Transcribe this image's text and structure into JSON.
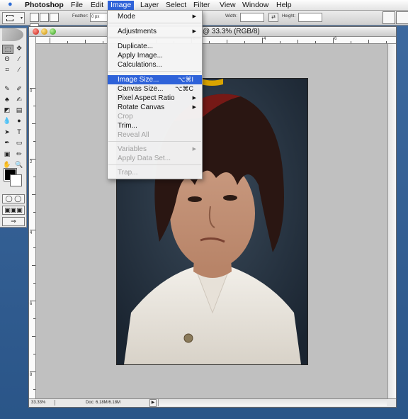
{
  "menubar": {
    "app_name": "Photoshop",
    "items": [
      "File",
      "Edit",
      "Image",
      "Layer",
      "Select",
      "Filter",
      "View",
      "Window",
      "Help"
    ],
    "active": "Image"
  },
  "options_bar": {
    "feather_label": "Feather:",
    "feather_value": "0 px",
    "width_label": "Width:",
    "height_label": "Height:",
    "swap_glyph": "⇄"
  },
  "document": {
    "title": "@ 33.3% (RGB/8)",
    "zoom": "33.33%",
    "doc_size": "Doc: 6.18M/6.18M",
    "ruler_h_labels": [
      "0",
      "2",
      "4",
      "6"
    ],
    "ruler_v_labels": [
      "0",
      "2",
      "4",
      "6",
      "8",
      "10"
    ]
  },
  "image_menu": {
    "items": [
      {
        "label": "Mode",
        "submenu": true
      },
      {
        "label": "Adjustments",
        "submenu": true
      },
      {
        "label": "Duplicate..."
      },
      {
        "label": "Apply Image..."
      },
      {
        "label": "Calculations..."
      },
      {
        "label": "Image Size...",
        "shortcut": "⌥⌘I",
        "highlighted": true
      },
      {
        "label": "Canvas Size...",
        "shortcut": "⌥⌘C"
      },
      {
        "label": "Pixel Aspect Ratio",
        "submenu": true
      },
      {
        "label": "Rotate Canvas",
        "submenu": true
      },
      {
        "label": "Crop",
        "disabled": true
      },
      {
        "label": "Trim..."
      },
      {
        "label": "Reveal All",
        "disabled": true
      },
      {
        "label": "Variables",
        "submenu": true,
        "disabled": true
      },
      {
        "label": "Apply Data Set...",
        "disabled": true
      },
      {
        "label": "Trap...",
        "disabled": true
      }
    ]
  },
  "colors": {
    "menu_highlight": "#2e62d9",
    "desktop": "#2f5c8f",
    "canvas_bg": "#c0c0c0"
  }
}
